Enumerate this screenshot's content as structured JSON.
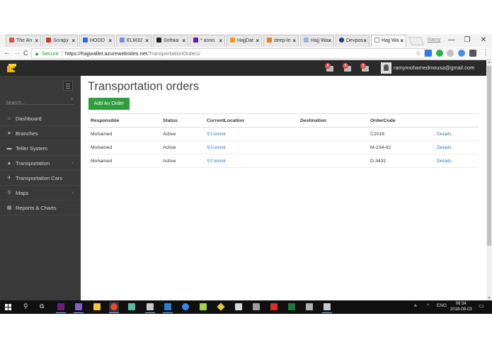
{
  "browser": {
    "tabs": [
      {
        "label": "The An",
        "color": "#e74c3c"
      },
      {
        "label": "Scrapy",
        "color": "#c0392b"
      },
      {
        "label": "HOOD",
        "color": "#2d6cdf"
      },
      {
        "label": "ELM32",
        "color": "#7d8bd6"
      },
      {
        "label": "Softwa",
        "color": "#222222"
      },
      {
        "label": "* anno",
        "color": "#6a1b9a"
      },
      {
        "label": "HajjDat",
        "color": "#f39c12"
      },
      {
        "label": "deep-le",
        "color": "#e67e22"
      },
      {
        "label": "Hajj Wa",
        "color": "#9fb6d9"
      },
      {
        "label": "Devpos",
        "color": "#1d3c6e"
      },
      {
        "label": "Hajj Wa",
        "color": "#bbbbbb"
      }
    ],
    "tab_close": "×",
    "profile_name": "Ramy",
    "window_minimize": "—",
    "window_maximize": "❐",
    "window_close": "✕",
    "nav_back": "←",
    "nav_forward": "→",
    "nav_reload": "C",
    "secure_label": "Secure",
    "url_base": "https://hajjwallet.azurewebsites.net",
    "url_path": "/TransportationOrders/",
    "bookmark_star": "☆"
  },
  "app": {
    "notifications": [
      {
        "count": "6"
      },
      {
        "count": "5"
      },
      {
        "count": "5"
      }
    ],
    "user_email": "ramymohamedmousa@gmail.com",
    "user_caret": "⌄",
    "sidebar": {
      "search_placeholder": "Search...",
      "search_icon": "⌕",
      "items": [
        {
          "label": "Dashboard",
          "icon": "⌂",
          "chevron": ""
        },
        {
          "label": "Branches",
          "icon": "➤",
          "chevron": ""
        },
        {
          "label": "Teller System",
          "icon": "▬",
          "chevron": ""
        },
        {
          "label": "Transportation",
          "icon": "▲",
          "chevron": "‹"
        },
        {
          "label": "Transportation Cars",
          "icon": "✈",
          "chevron": ""
        },
        {
          "label": "Maps",
          "icon": "⚲",
          "chevron": "‹"
        },
        {
          "label": "Reports & Charts",
          "icon": "▦",
          "chevron": ""
        }
      ]
    },
    "page_title": "Transportation orders",
    "add_button": "Add An Order",
    "table": {
      "headers": [
        "Responsible",
        "Status",
        "CurrentLocation",
        "Destination",
        "OrderCode",
        ""
      ],
      "rows": [
        {
          "responsible": "Mohamed",
          "status": "Active",
          "location": "Current",
          "destination": "",
          "code": "C2016",
          "action": "Details"
        },
        {
          "responsible": "Mohamed",
          "status": "Active",
          "location": "Current",
          "destination": "",
          "code": "M-234-42",
          "action": "Details"
        },
        {
          "responsible": "Mohamed",
          "status": "Active",
          "location": "Current",
          "destination": "",
          "code": "D-3432",
          "action": "Details"
        }
      ]
    }
  },
  "taskbar": {
    "lang": "ENG",
    "time": "06:34",
    "date": "2018-08-03"
  }
}
